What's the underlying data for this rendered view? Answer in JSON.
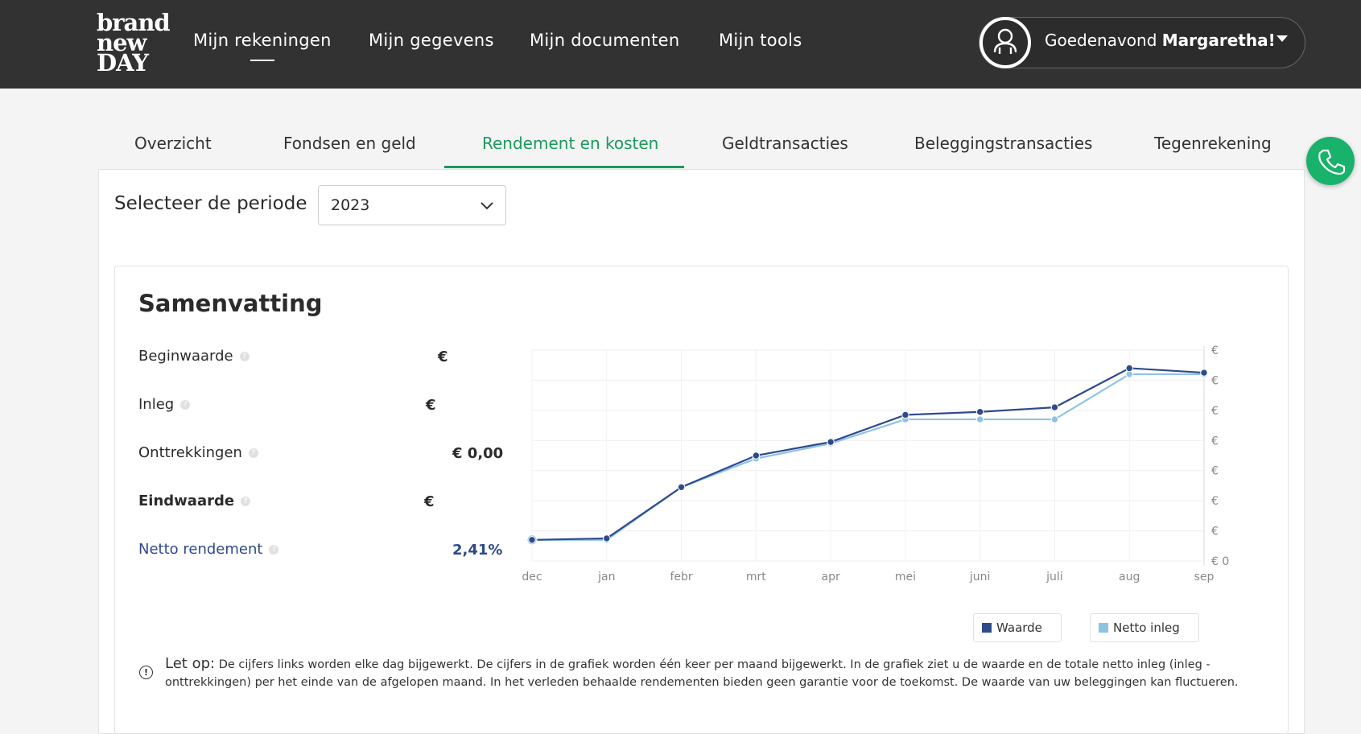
{
  "header": {
    "logo_lines": [
      "brand",
      "new",
      "DAY"
    ],
    "nav": [
      "Mijn rekeningen",
      "Mijn gegevens",
      "Mijn documenten",
      "Mijn tools"
    ],
    "greeting": "Goedenavond",
    "user_name": "Margaretha!"
  },
  "tabs": [
    "Overzicht",
    "Fondsen en geld",
    "Rendement en kosten",
    "Geldtransacties",
    "Beleggingstransacties",
    "Tegenrekening"
  ],
  "active_tab": "Rendement en kosten",
  "period": {
    "label": "Selecteer de periode",
    "selected": "2023"
  },
  "summary": {
    "title": "Samenvatting",
    "rows": [
      {
        "label": "Beginwaarde",
        "value": "€"
      },
      {
        "label": "Inleg",
        "value": "€"
      },
      {
        "label": "Onttrekkingen",
        "value": "€ 0,00"
      },
      {
        "label": "Eindwaarde",
        "value": "€"
      },
      {
        "label": "Netto rendement",
        "value": "2,41%"
      }
    ]
  },
  "chart_data": {
    "type": "line",
    "categories": [
      "dec",
      "jan",
      "febr",
      "mrt",
      "apr",
      "mei",
      "juni",
      "juli",
      "aug",
      "sep"
    ],
    "y_tick_labels": [
      "€",
      "€",
      "€",
      "€",
      "€",
      "€",
      "€",
      "€ 0"
    ],
    "ylim": [
      0,
      7
    ],
    "grid": true,
    "legend_position": "bottom-right",
    "series": [
      {
        "name": "Waarde",
        "color": "#2e4a8c",
        "values": [
          0.7,
          0.75,
          2.45,
          3.5,
          3.95,
          4.85,
          4.95,
          5.1,
          6.4,
          6.25
        ]
      },
      {
        "name": "Netto inleg",
        "color": "#8ec3e6",
        "values": [
          0.7,
          0.7,
          2.45,
          3.4,
          3.9,
          4.7,
          4.7,
          4.7,
          6.2,
          6.2
        ]
      }
    ]
  },
  "legend": [
    "Waarde",
    "Netto inleg"
  ],
  "note": {
    "title": "Let op:",
    "text": "De cijfers links worden elke dag bijgewerkt. De cijfers in de grafiek worden één keer per maand bijgewerkt. In de grafiek ziet u de waarde en de totale netto inleg (inleg - onttrekkingen) per het einde van de afgelopen maand. In het verleden behaalde rendementen bieden geen garantie voor de toekomst. De waarde van uw beleggingen kan fluctueren."
  },
  "colors": {
    "accent": "#1a9a5c",
    "topbar": "#323232",
    "phone": "#18b26b"
  },
  "icons": {
    "avatar": "user-icon",
    "dropdown": "caret-down-icon",
    "phone": "phone-icon",
    "help": "help-icon",
    "info": "info-icon"
  }
}
